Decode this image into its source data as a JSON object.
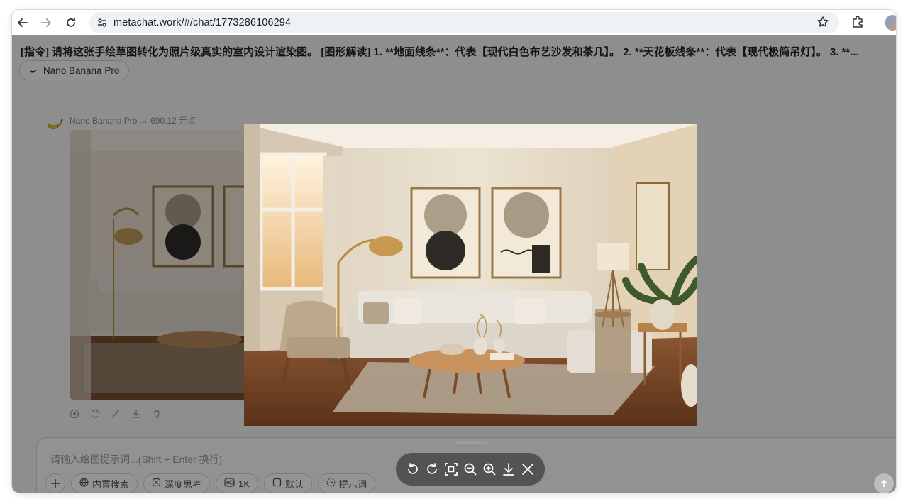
{
  "browser": {
    "url": "metachat.work/#/chat/1773286106294",
    "icons": [
      "back-arrow-icon",
      "forward-arrow-icon",
      "reload-icon",
      "site-settings-icon",
      "bookmark-star-icon",
      "extensions-icon",
      "profile-avatar-icon"
    ]
  },
  "chat": {
    "prompt_title": "[指令] 请将这张手绘草图转化为照片级真实的室内设计渲染图。 [图形解读] 1. **地面线条**：代表【现代白色布艺沙发和茶几】。 2. **天花板线条**：代表【现代极简吊灯】。 3. **...",
    "model_pill": "Nano Banana Pro",
    "message_meta": "Nano Banana Pro → 690.12 元点",
    "actions": [
      "target-icon",
      "regenerate-icon",
      "edit-wand-icon",
      "download-icon",
      "delete-icon"
    ]
  },
  "composer": {
    "placeholder": "请输入绘图提示词...(Shift + Enter 换行)",
    "chips": {
      "search": "内置搜索",
      "think": "深度思考",
      "resolution": "1K",
      "default": "默认",
      "hint": "提示词"
    }
  },
  "viewer": {
    "tools": [
      "rotate-left-icon",
      "rotate-right-icon",
      "fit-screen-icon",
      "zoom-out-icon",
      "zoom-in-icon",
      "download-icon",
      "close-icon"
    ]
  },
  "colors": {
    "wall": "#e9e1d3",
    "floor": "#7a4a2a",
    "sofa": "#e7e2da",
    "accent_brass": "#c39a55"
  }
}
